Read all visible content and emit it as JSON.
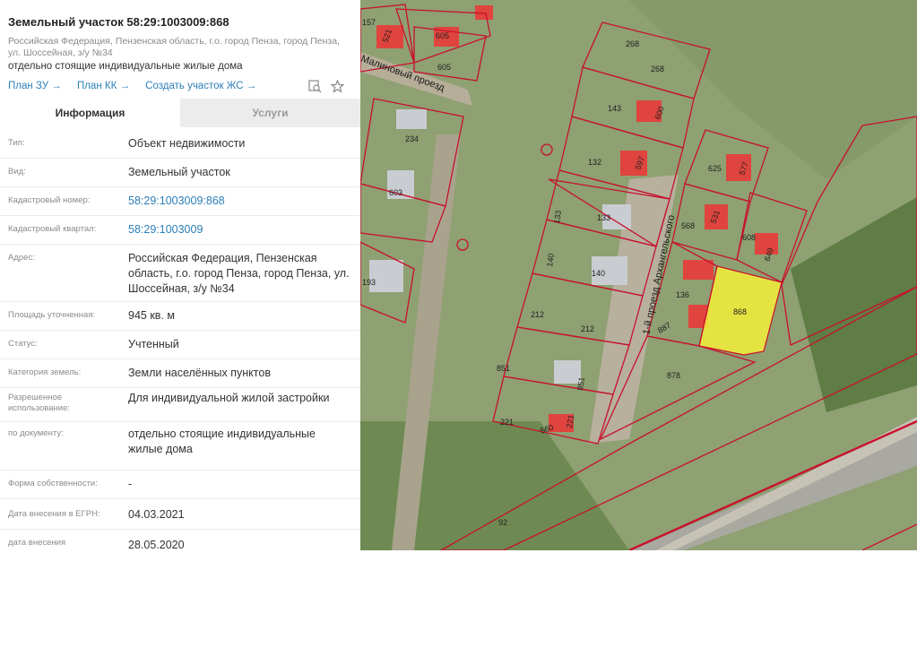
{
  "panel": {
    "title": "Земельный участок 58:29:1003009:868",
    "address_top": "Российская Федерация, Пензенская область, г.о. город Пенза, город Пенза, ул. Шоссейная, з/у №34",
    "subtitle": "отдельно стоящие индивидуальные жилые дома",
    "links": [
      "План ЗУ →",
      "План КК →",
      "Создать участок ЖС →"
    ],
    "icons": [
      "search-map-icon",
      "star-icon"
    ],
    "tabs": {
      "info": "Информация",
      "services": "Услуги"
    },
    "rows": [
      {
        "label": "Тип:",
        "value": "Объект недвижимости"
      },
      {
        "label": "Вид:",
        "value": "Земельный участок"
      },
      {
        "label": "Кадастровый номер:",
        "value": "58:29:1003009:868"
      },
      {
        "label": "Кадастровый квартал:",
        "value": "58:29:1003009"
      },
      {
        "label": "Адрес:",
        "value": "Российская Федерация, Пензенская область, г.о. город Пенза, город Пенза, ул. Шоссейная, з/у №34"
      },
      {
        "label": "Площадь уточненная:",
        "value": "945 кв. м"
      },
      {
        "label": "Статус:",
        "value": "Учтенный"
      },
      {
        "label": "Категория земель:",
        "value": "Земли населённых пунктов"
      },
      {
        "label": "Разрешенное использование:",
        "value": "Для индивидуальной жилой застройки"
      },
      {
        "label": "по документу:",
        "value": "отдельно стоящие индивидуальные жилые дома"
      },
      {
        "label": "Форма собственности:",
        "value": "-"
      },
      {
        "label": "Дата внесения в ЕГРН:",
        "value": "04.03.2021"
      },
      {
        "label": "дата внесения",
        "value": "28.05.2020"
      }
    ]
  },
  "map": {
    "streets": [
      "Малиновый проезд",
      "1-й проезд Архангельского"
    ],
    "selected_plot": "868",
    "plot_numbers": [
      "157",
      "521",
      "605",
      "605",
      "268",
      "268",
      "143",
      "600",
      "234",
      "132",
      "597",
      "625",
      "577",
      "603",
      "133",
      "133",
      "568",
      "531",
      "608",
      "649",
      "140",
      "140",
      "136",
      "868",
      "193",
      "212",
      "212",
      "887",
      "878",
      "851",
      "851",
      "221",
      "221",
      "560",
      "92"
    ],
    "colors": {
      "boundary": "#c8102e",
      "selected_fill": "#f4ee3a",
      "roof": "#e0443e"
    }
  }
}
